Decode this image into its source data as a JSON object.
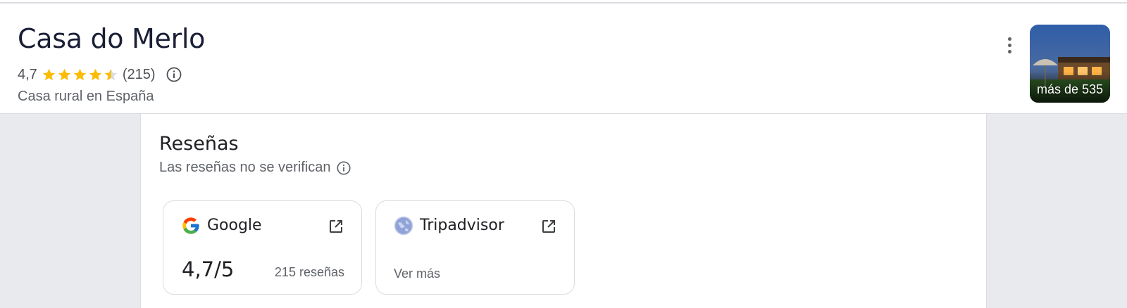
{
  "place": {
    "title": "Casa do Merlo",
    "rating": "4,7",
    "star_rating": 4.7,
    "rating_count": "(215)",
    "category": "Casa rural en España",
    "info_icon": "info-icon",
    "more_icon": "more-vert-icon",
    "photo_label": "más de 535"
  },
  "reviews": {
    "title": "Reseñas",
    "disclaimer": "Las reseñas no se verifican",
    "info_icon": "info-icon",
    "sources": [
      {
        "name": "Google",
        "logo": "google-g-logo",
        "score": "4,7/5",
        "count": "215 reseñas",
        "link_icon": "open-in-new-icon"
      },
      {
        "name": "Tripadvisor",
        "logo": "globe-icon",
        "more_label": "Ver más",
        "link_icon": "open-in-new-icon"
      }
    ]
  },
  "colors": {
    "star": "#fbbc04",
    "star_empty": "#dadce0",
    "title": "#1a1f36",
    "secondary_text": "#5f6368",
    "background": "#e8eaed"
  }
}
